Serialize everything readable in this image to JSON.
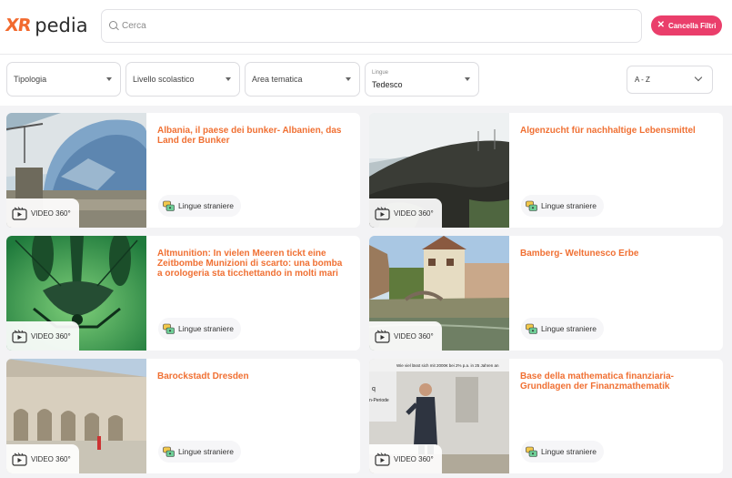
{
  "header": {
    "logo_mark": "XR",
    "logo_text": "pedia",
    "search_placeholder": "Cerca",
    "clear_label": "Cancella Filtri"
  },
  "filters": {
    "tipologia": "Tipologia",
    "livello": "Livello scolastico",
    "area": "Area tematica",
    "lingue_label": "Lingue",
    "lingue_value": "Tedesco",
    "sort": "A - Z"
  },
  "colors": {
    "accent": "#f07033",
    "clear_button": "#ea3e6b"
  },
  "cards": [
    {
      "title": "Albania, il paese dei bunker- Albanien, das Land der Bunker",
      "badge": "VIDEO 360°",
      "tag": "Lingue straniere"
    },
    {
      "title": "Algenzucht für nachhaltige Lebensmittel",
      "badge": "VIDEO 360°",
      "tag": "Lingue straniere"
    },
    {
      "title": "Altmunition: In vielen Meeren tickt eine Zeitbombe Munizioni di scarto: una bomba a orologeria sta ticchettando in molti mari",
      "badge": "VIDEO 360°",
      "tag": "Lingue straniere"
    },
    {
      "title": "Bamberg- Weltunesco Erbe",
      "badge": "VIDEO 360°",
      "tag": "Lingue straniere"
    },
    {
      "title": "Barockstadt Dresden",
      "badge": "VIDEO 360°",
      "tag": "Lingue straniere"
    },
    {
      "title": "Base della mathematica finanziaria- Grundlagen der Finanzmathematik",
      "badge": "VIDEO 360°",
      "tag": "Lingue straniere"
    }
  ],
  "thumb_text": {
    "slide_header": "Wie viel lässt sich mit 2000€ bei 2% p.a. in 25 Jahren an",
    "slide_q": "q",
    "slide_period": "n-Periode"
  }
}
